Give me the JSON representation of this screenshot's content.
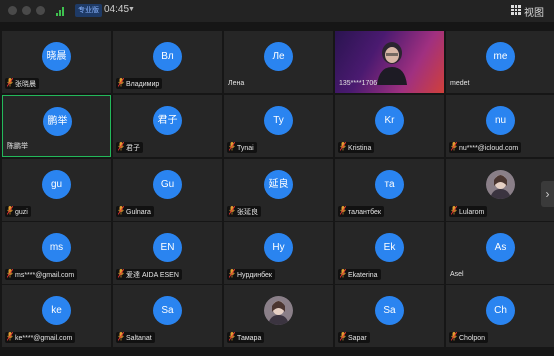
{
  "titlebar": {
    "pro_badge": "专业版",
    "timer": "04:45",
    "view_label": "视图",
    "colors": {
      "signal": "#3ec24f",
      "badge_bg": "#1e3a66"
    }
  },
  "tiles": [
    {
      "avatar": "晓晨",
      "name": "张晓晨",
      "muted": true
    },
    {
      "avatar": "Вл",
      "name": "Владимир",
      "muted": true
    },
    {
      "avatar": "Ле",
      "name": "Лена",
      "muted": false
    },
    {
      "video": true,
      "name": "135****1706",
      "muted": false
    },
    {
      "avatar": "me",
      "name": "medet",
      "muted": false
    },
    {
      "avatar": "鹏举",
      "name": "陈鹏举",
      "muted": false,
      "active": true
    },
    {
      "avatar": "君子",
      "name": "君子",
      "muted": true
    },
    {
      "avatar": "Ty",
      "name": "Tynai",
      "muted": true
    },
    {
      "avatar": "Kr",
      "name": "Kristina",
      "muted": true
    },
    {
      "avatar": "nu",
      "name": "nu****@icloud.com",
      "muted": true
    },
    {
      "avatar": "gu",
      "name": "guzi",
      "muted": true
    },
    {
      "avatar": "Gu",
      "name": "Gulnara",
      "muted": true
    },
    {
      "avatar": "延良",
      "name": "张延良",
      "muted": true
    },
    {
      "avatar": "та",
      "name": "талантбек",
      "muted": true
    },
    {
      "avatar": "",
      "photo": true,
      "name": "Lularom",
      "muted": true
    },
    {
      "avatar": "ms",
      "name": "ms****@gmail.com",
      "muted": true
    },
    {
      "avatar": "EN",
      "name": "爱達 AIDA ESEN",
      "muted": true
    },
    {
      "avatar": "Ну",
      "name": "Нурдинбек",
      "muted": true
    },
    {
      "avatar": "Ek",
      "name": "Ekaterina",
      "muted": true
    },
    {
      "avatar": "As",
      "name": "Asel",
      "muted": false
    },
    {
      "avatar": "ke",
      "name": "ke****@gmail.com",
      "muted": true
    },
    {
      "avatar": "Sa",
      "name": "Saltanat",
      "muted": true
    },
    {
      "avatar": "",
      "photo": true,
      "name": "Тамара",
      "muted": true
    },
    {
      "avatar": "Sa",
      "name": "Sapar",
      "muted": true
    },
    {
      "avatar": "Ch",
      "name": "Cholpon",
      "muted": true
    }
  ],
  "colors": {
    "avatar_bg": "#2a84f0",
    "active_border": "#23b85a",
    "tile_bg": "#262626"
  },
  "icons": {
    "next_page": "chevron-right-icon",
    "mic": "mic-muted-icon",
    "view": "grid-view-icon"
  }
}
